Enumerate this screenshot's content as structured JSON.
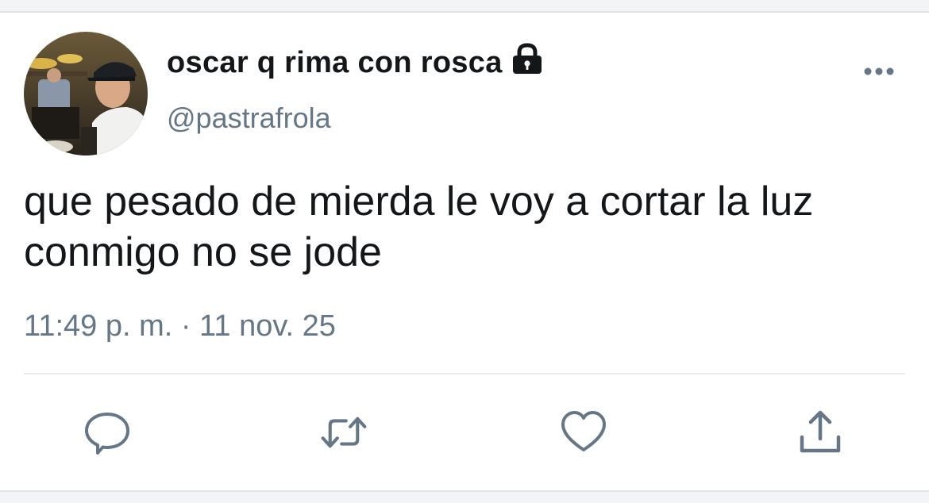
{
  "user": {
    "display_name": "oscar q rima con rosca",
    "handle": "@pastrafrola",
    "protected_icon": "lock-icon",
    "avatar": "profile-photo"
  },
  "tweet": {
    "text": "que pesado de mierda le voy a cortar la luz\nconmigo no se jode",
    "timestamp": "11:49 p. m. · 11 nov. 25"
  },
  "actions": {
    "reply_icon": "reply-icon",
    "retweet_icon": "retweet-icon",
    "like_icon": "heart-icon",
    "share_icon": "share-icon",
    "more_icon": "more-options-icon"
  },
  "colors": {
    "text_primary": "#14171a",
    "text_secondary": "#657786",
    "icon": "#657786",
    "divider": "#e6ecf0"
  }
}
